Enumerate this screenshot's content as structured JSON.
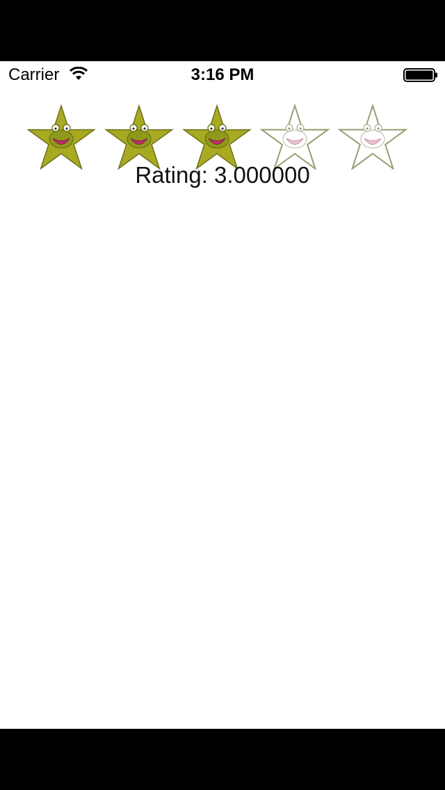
{
  "status_bar": {
    "carrier": "Carrier",
    "time": "3:16 PM",
    "wifi_icon": "wifi-icon",
    "battery_icon": "battery-icon"
  },
  "rating": {
    "value": 3,
    "max": 5,
    "label": "Rating: 3.000000",
    "star_icons": [
      "frog-star-filled-icon",
      "frog-star-filled-icon",
      "frog-star-filled-icon",
      "frog-star-empty-icon",
      "frog-star-empty-icon"
    ]
  },
  "colors": {
    "star_filled": "#a8aa22",
    "star_outline": "#6e7018",
    "smile": "#c0306a",
    "frame": "#000000",
    "background": "#ffffff"
  }
}
